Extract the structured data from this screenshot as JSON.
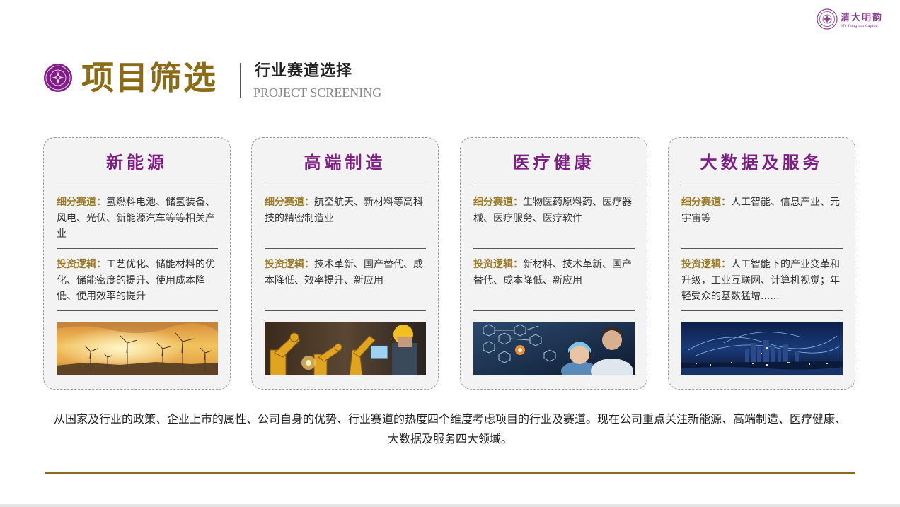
{
  "brand": {
    "name_cn": "清大明韵",
    "name_en": "MY Tsinghua Capital"
  },
  "header": {
    "title": "项目筛选",
    "subtitle_cn": "行业赛道选择",
    "subtitle_en": "PROJECT SCREENING"
  },
  "cards": [
    {
      "title": "新能源",
      "segment_label": "细分赛道：",
      "segment_text": "氢燃料电池、储氢装备、风电、光伏、新能源汽车等等相关产业",
      "logic_label": "投资逻辑：",
      "logic_text": "工艺优化、储能材料的优化、储能密度的提升、使用成本降低、使用效率的提升",
      "image": "wind-turbines-sunset"
    },
    {
      "title": "高端制造",
      "segment_label": "细分赛道：",
      "segment_text": "航空航天、新材料等高科技的精密制造业",
      "logic_label": "投资逻辑：",
      "logic_text": "技术革新、国产替代、成本降低、效率提升、新应用",
      "image": "industrial-robot-arms"
    },
    {
      "title": "医疗健康",
      "segment_label": "细分赛道：",
      "segment_text": "生物医药原料药、医疗器械、医疗服务、医疗软件",
      "logic_label": "投资逻辑：",
      "logic_text": "新材料、技术革新、国产替代、成本降低、新应用",
      "image": "medical-technology"
    },
    {
      "title": "大数据及服务",
      "segment_label": "细分赛道：",
      "segment_text": "人工智能、信息产业、元宇宙等",
      "logic_label": "投资逻辑：",
      "logic_text": "人工智能下的产业变革和升级，工业互联网、计算机视觉；年轻受众的基数猛增......",
      "image": "night-city-network"
    }
  ],
  "summary": "从国家及行业的政策、企业上市的属性、公司自身的优势、行业赛道的热度四个维度考虑项目的行业及赛道。现在公司重点关注新能源、高端制造、医疗健康、大数据及服务四大领域。",
  "colors": {
    "gold": "#8b6b14",
    "purple": "#7e1d84",
    "label_gold": "#9b7a28"
  }
}
